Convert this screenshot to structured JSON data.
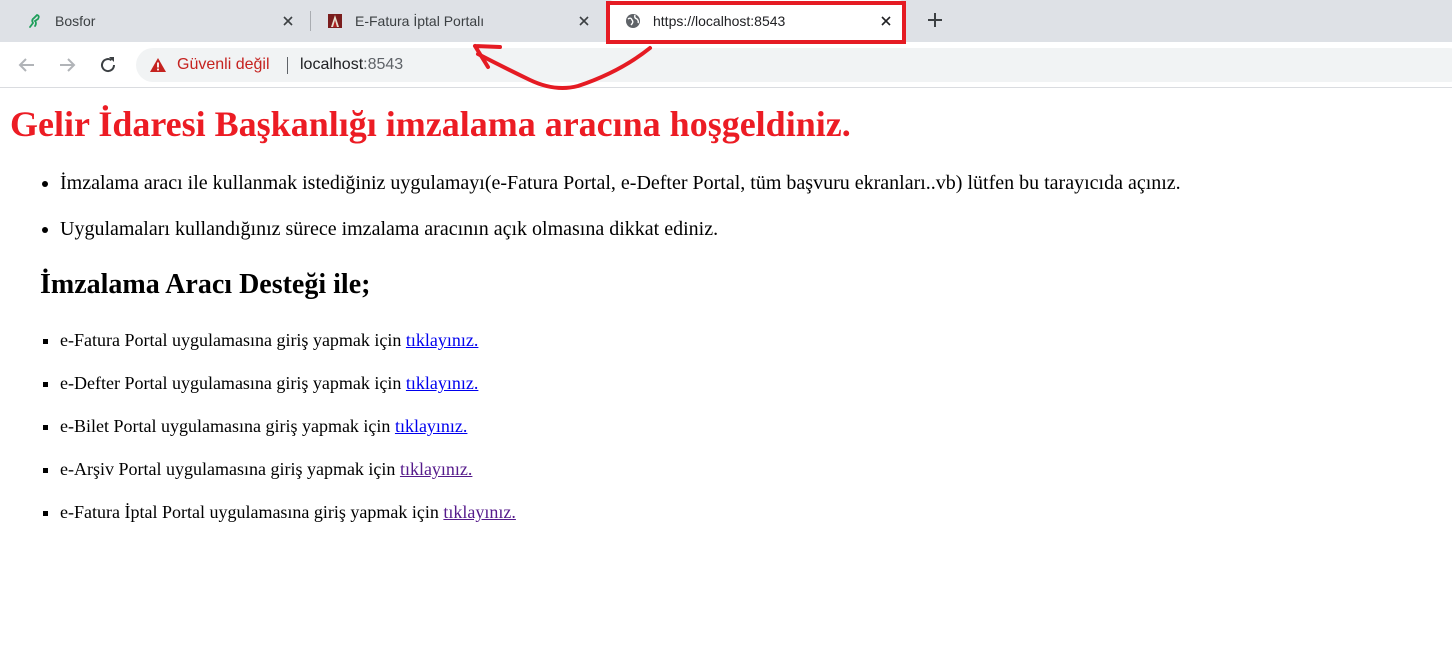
{
  "browser": {
    "tabs": [
      {
        "title": "Bosfor",
        "icon": "bosfor-logo-icon",
        "active": false
      },
      {
        "title": "E-Fatura İptal Portalı",
        "icon": "gib-logo-icon",
        "active": false
      },
      {
        "title": "https://localhost:8543",
        "icon": "globe-icon",
        "active": true
      }
    ],
    "new_tab_icon": "plus-icon",
    "omnibox": {
      "security_label": "Güvenli değil",
      "host": "localhost",
      "port": ":8543"
    },
    "colors": {
      "tabstrip": "#dee1e6",
      "warning": "#c5221f",
      "annotation": "#e51b23"
    }
  },
  "page": {
    "title": "Gelir İdaresi Başkanlığı imzalama aracına hoşgeldiniz.",
    "title_color": "#ec1c24",
    "info_items": [
      "İmzalama aracı ile kullanmak istediğiniz uygulamayı(e-Fatura Portal, e-Defter Portal, tüm başvuru ekranları..vb) lütfen bu tarayıcıda açınız.",
      "Uygulamaları kullandığınız sürece imzalama aracının açık olmasına dikkat ediniz."
    ],
    "support_heading": "İmzalama Aracı Desteği ile;",
    "links": [
      {
        "text": "e-Fatura Portal uygulamasına giriş yapmak için",
        "link": "tıklayınız.",
        "visited": false
      },
      {
        "text": "e-Defter Portal uygulamasına giriş yapmak için",
        "link": "tıklayınız.",
        "visited": false
      },
      {
        "text": "e-Bilet Portal uygulamasına giriş yapmak için",
        "link": "tıklayınız.",
        "visited": false
      },
      {
        "text": "e-Arşiv Portal uygulamasına giriş yapmak için",
        "link": "tıklayınız.",
        "visited": true
      },
      {
        "text": "e-Fatura İptal Portal uygulamasına giriş yapmak için",
        "link": "tıklayınız.",
        "visited": true
      }
    ]
  }
}
